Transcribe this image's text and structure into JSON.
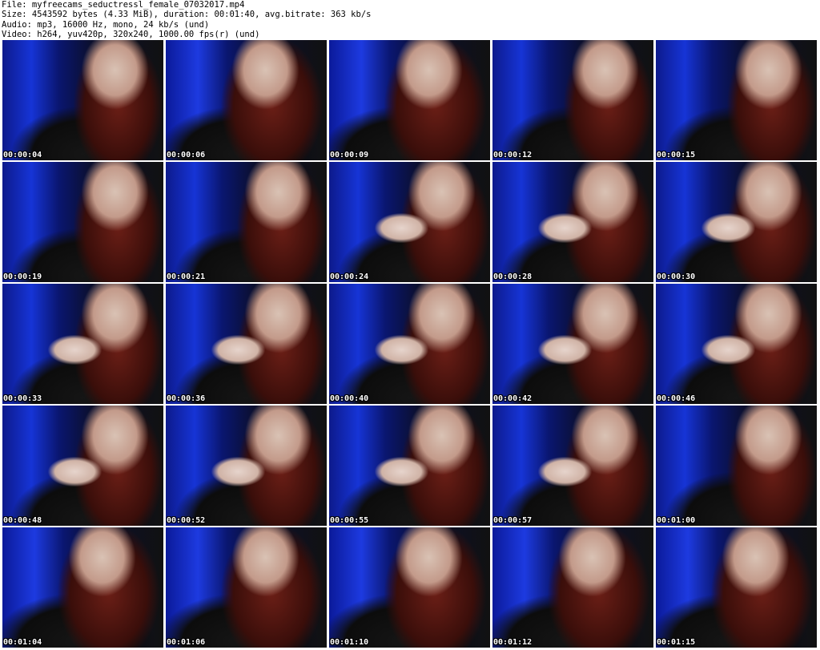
{
  "header": {
    "file": "File: myfreecams_seductressl_female_07032017.mp4",
    "size": "Size: 4543592 bytes (4.33 MiB), duration: 00:01:40, avg.bitrate: 363 kb/s",
    "audio": "Audio: mp3, 16000 Hz, mono, 24 kb/s (und)",
    "video": "Video: h264, yuv420p, 320x240, 1000.00 fps(r) (und)"
  },
  "thumbnails": [
    {
      "timestamp": "00:00:04"
    },
    {
      "timestamp": "00:00:06"
    },
    {
      "timestamp": "00:00:09"
    },
    {
      "timestamp": "00:00:12"
    },
    {
      "timestamp": "00:00:15"
    },
    {
      "timestamp": "00:00:19"
    },
    {
      "timestamp": "00:00:21"
    },
    {
      "timestamp": "00:00:24"
    },
    {
      "timestamp": "00:00:28"
    },
    {
      "timestamp": "00:00:30"
    },
    {
      "timestamp": "00:00:33"
    },
    {
      "timestamp": "00:00:36"
    },
    {
      "timestamp": "00:00:40"
    },
    {
      "timestamp": "00:00:42"
    },
    {
      "timestamp": "00:00:46"
    },
    {
      "timestamp": "00:00:48"
    },
    {
      "timestamp": "00:00:52"
    },
    {
      "timestamp": "00:00:55"
    },
    {
      "timestamp": "00:00:57"
    },
    {
      "timestamp": "00:01:00"
    },
    {
      "timestamp": "00:01:04"
    },
    {
      "timestamp": "00:01:06"
    },
    {
      "timestamp": "00:01:10"
    },
    {
      "timestamp": "00:01:12"
    },
    {
      "timestamp": "00:01:15"
    }
  ]
}
